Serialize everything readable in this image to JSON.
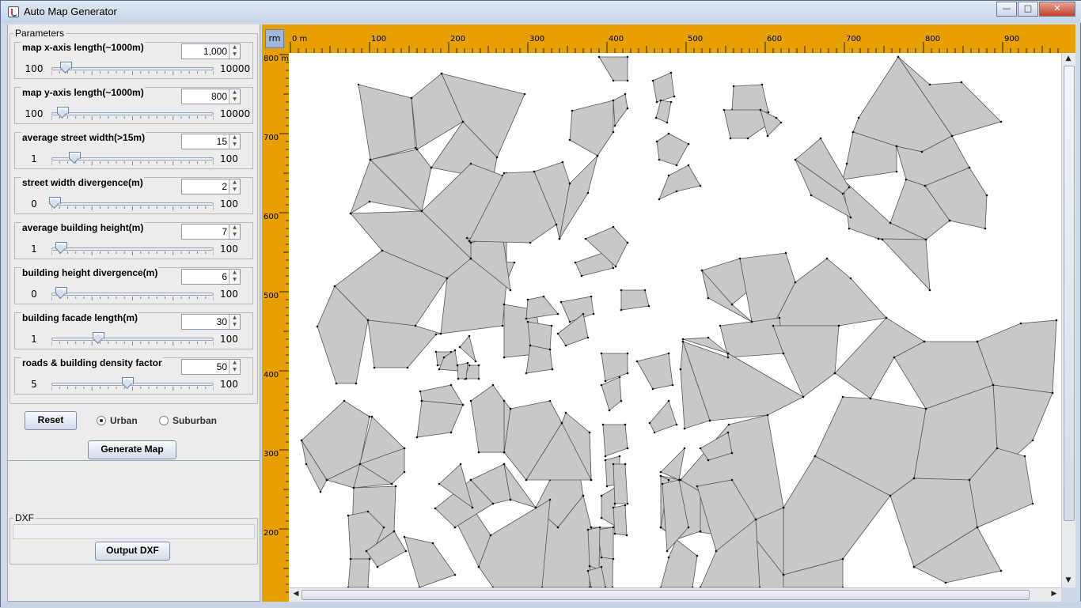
{
  "window": {
    "title": "Auto Map Generator",
    "controls": {
      "minimize": "—",
      "maximize": "□",
      "close": "✕"
    }
  },
  "parameters": {
    "legend": "Parameters",
    "items": [
      {
        "label": "map x-axis length(~1000m)",
        "value": "1,000",
        "min": "100",
        "max": "10000",
        "level": 0.09
      },
      {
        "label": "map y-axis length(~1000m)",
        "value": "800",
        "min": "100",
        "max": "10000",
        "level": 0.07
      },
      {
        "label": "average street width(>15m)",
        "value": "15",
        "min": "1",
        "max": "100",
        "level": 0.14
      },
      {
        "label": "street width divergence(m)",
        "value": "2",
        "min": "0",
        "max": "100",
        "level": 0.02
      },
      {
        "label": "average building height(m)",
        "value": "7",
        "min": "1",
        "max": "100",
        "level": 0.06
      },
      {
        "label": "building height divergence(m)",
        "value": "6",
        "min": "0",
        "max": "100",
        "level": 0.06
      },
      {
        "label": "building facade length(m)",
        "value": "30",
        "min": "1",
        "max": "100",
        "level": 0.29
      },
      {
        "label": "roads & building density factor",
        "value": "50",
        "min": "5",
        "max": "100",
        "level": 0.47
      }
    ]
  },
  "actions": {
    "reset_label": "Reset",
    "urban_label": "Urban",
    "suburban_label": "Suburban",
    "generate_label": "Generate Map"
  },
  "dxf": {
    "legend": "DXF",
    "output_label": "Output DXF"
  },
  "ruler": {
    "corner_label": "rm",
    "x_labels": [
      "0 m",
      "100",
      "200",
      "300",
      "400",
      "500",
      "600",
      "700",
      "800",
      "900"
    ],
    "y_labels": [
      "800 m",
      "700",
      "600",
      "500",
      "400",
      "300",
      "200"
    ]
  },
  "colors": {
    "ruler": "#e8a000",
    "building_fill": "#c8c8c8",
    "building_stroke": "#555555"
  }
}
